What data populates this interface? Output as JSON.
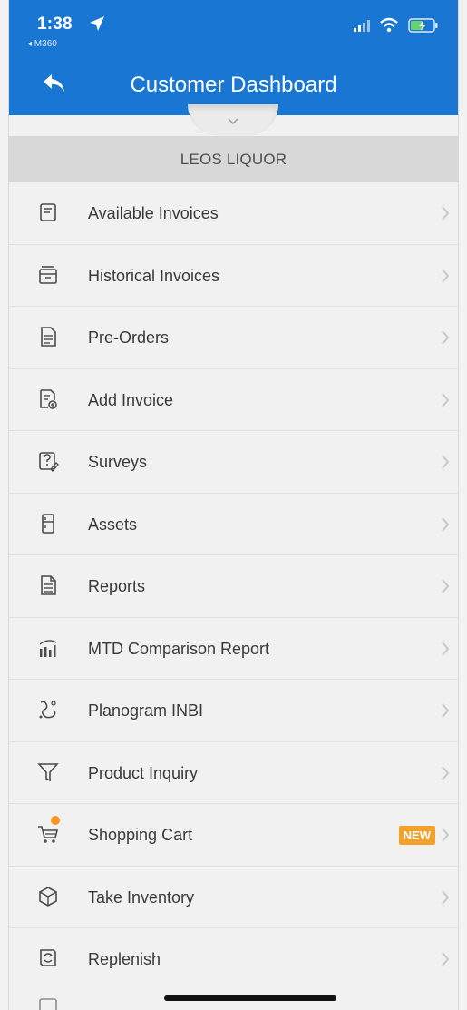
{
  "status": {
    "time": "1:38",
    "back_app": "◂ M360"
  },
  "nav": {
    "title": "Customer Dashboard",
    "back_icon": "back-arrow-icon"
  },
  "customer": {
    "name": "LEOS LIQUOR"
  },
  "menu": [
    {
      "label": "Available Invoices",
      "icon": "available-invoices-icon"
    },
    {
      "label": "Historical Invoices",
      "icon": "historical-invoices-icon"
    },
    {
      "label": "Pre-Orders",
      "icon": "pre-orders-icon"
    },
    {
      "label": "Add Invoice",
      "icon": "add-invoice-icon"
    },
    {
      "label": "Surveys",
      "icon": "surveys-icon"
    },
    {
      "label": "Assets",
      "icon": "assets-icon"
    },
    {
      "label": "Reports",
      "icon": "reports-icon"
    },
    {
      "label": "MTD Comparison Report",
      "icon": "mtd-comparison-report-icon"
    },
    {
      "label": "Planogram INBI",
      "icon": "planogram-icon"
    },
    {
      "label": "Product Inquiry",
      "icon": "product-inquiry-filter-icon"
    },
    {
      "label": "Shopping Cart",
      "icon": "shopping-cart-icon",
      "badge": "NEW"
    },
    {
      "label": "Take Inventory",
      "icon": "take-inventory-icon"
    },
    {
      "label": "Replenish",
      "icon": "replenish-icon"
    }
  ],
  "partial": {
    "label": ""
  },
  "colors": {
    "header": "#1976d2",
    "badge": "#f4a12c",
    "background": "#f1f1f1"
  }
}
